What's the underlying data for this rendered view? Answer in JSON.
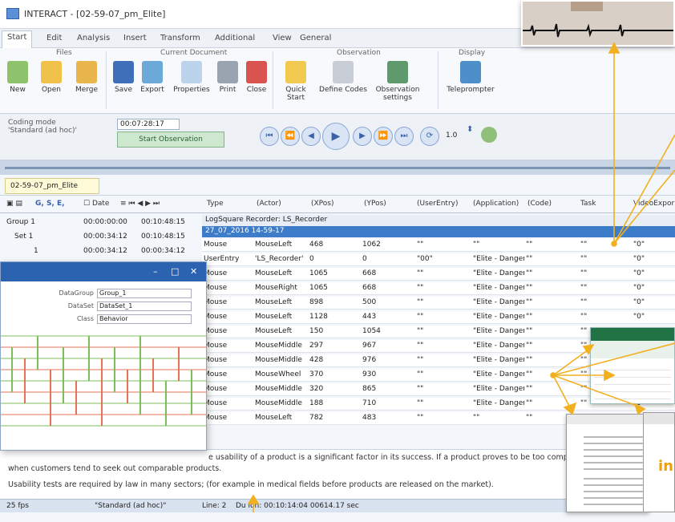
{
  "window": {
    "title": "INTERACT - [02-59-07_pm_Elite]"
  },
  "menu": [
    "Start",
    "Edit",
    "Analysis",
    "Insert",
    "Transform",
    "Additional",
    "View",
    "General"
  ],
  "ribbon": {
    "groups": {
      "files": "Files",
      "current_document": "Current Document",
      "observation": "Observation",
      "display": "Display"
    },
    "buttons": {
      "new": "New",
      "open": "Open",
      "merge": "Merge",
      "save": "Save",
      "export": "Export",
      "properties": "Properties",
      "print": "Print",
      "close": "Close",
      "quick_start": "Quick Start",
      "define_codes": "Define Codes",
      "observation_settings": "Observation settings",
      "teleprompter": "Teleprompter"
    }
  },
  "coding": {
    "mode_label": "Coding mode",
    "mode_value": "'Standard (ad hoc)'",
    "time": "00:07:28:17",
    "start_button": "Start Observation",
    "speed": "1.0"
  },
  "document_tab": "02-59-07_pm_Elite",
  "grid_toolbar": {
    "date_label": "Date"
  },
  "grid_headers": [
    "Type",
    "(Actor)",
    "(XPos)",
    "(YPos)",
    "(UserEntry)",
    "(Application)",
    "(Code)",
    "Task",
    "VideoExpor"
  ],
  "tree": [
    {
      "label": "Group 1",
      "start": "00:00:00:00",
      "end": "00:10:48:15"
    },
    {
      "label": "Set 1",
      "start": "00:00:34:12",
      "end": "00:10:48:15"
    },
    {
      "label": "1",
      "start": "00:00:34:12",
      "end": "00:00:34:12"
    }
  ],
  "recorder_label": "LogSquare Recorder: LS_Recorder",
  "selected_row": "27_07_2016 14-59-17",
  "rows": [
    [
      "Mouse",
      "MouseLeft",
      "468",
      "1062",
      "\"\"",
      "\"\"",
      "\"\"",
      "\"\"",
      "\"0\""
    ],
    [
      "UserEntry",
      "'LS_Recorder'",
      "0",
      "0",
      "\"00\"",
      "\"Elite - Danger",
      "\"\"",
      "\"\"",
      "\"0\""
    ],
    [
      "Mouse",
      "MouseLeft",
      "1065",
      "668",
      "\"\"",
      "\"Elite - Danger",
      "\"\"",
      "\"\"",
      "\"0\""
    ],
    [
      "Mouse",
      "MouseRight",
      "1065",
      "668",
      "\"\"",
      "\"Elite - Danger",
      "\"\"",
      "\"\"",
      "\"0\""
    ],
    [
      "Mouse",
      "MouseLeft",
      "898",
      "500",
      "\"\"",
      "\"Elite - Danger",
      "\"\"",
      "\"\"",
      "\"0\""
    ],
    [
      "Mouse",
      "MouseLeft",
      "1128",
      "443",
      "\"\"",
      "\"Elite - Danger",
      "\"\"",
      "\"\"",
      "\"0\""
    ],
    [
      "Mouse",
      "MouseLeft",
      "150",
      "1054",
      "\"\"",
      "\"Elite - Danger",
      "\"\"",
      "\"\"",
      "\"0\""
    ],
    [
      "Mouse",
      "MouseMiddle",
      "297",
      "967",
      "\"\"",
      "\"Elite - Danger",
      "\"\"",
      "\"\"",
      "\"0\""
    ],
    [
      "Mouse",
      "MouseMiddle",
      "428",
      "976",
      "\"\"",
      "\"Elite - Danger",
      "\"\"",
      "\"\"",
      "\"0\""
    ],
    [
      "Mouse",
      "MouseWheel",
      "370",
      "930",
      "\"\"",
      "\"Elite - Danger",
      "\"\"",
      "\"\"",
      "\"0\""
    ],
    [
      "Mouse",
      "MouseMiddle",
      "320",
      "865",
      "\"\"",
      "\"Elite - Danger",
      "\"\"",
      "\"\"",
      "\"0\""
    ],
    [
      "Mouse",
      "MouseMiddle",
      "188",
      "710",
      "\"\"",
      "\"Elite - Danger",
      "\"\"",
      "\"\"",
      "\"0\""
    ],
    [
      "Mouse",
      "MouseLeft",
      "782",
      "483",
      "\"\"",
      "\"\"",
      "\"\"",
      "\"\"",
      "\"0\""
    ]
  ],
  "transcript": {
    "line1": "e usability of a product is a significant factor in its success. If a product proves to be too complicated",
    "line2": "when customers tend to seek out comparable products.",
    "line3": "Usability tests are required by law in many sectors; (for example in medical fields before products are released on the market)."
  },
  "status": {
    "fps": "25 fps",
    "mode": "\"Standard (ad hoc)\"",
    "line": "Line: 2",
    "duration": "Du   ion: 00:10:14:04   00614.17 sec"
  },
  "chart_window": {
    "labels": {
      "datagroup": "DataGroup",
      "dataset": "DataSet",
      "class": "Class"
    },
    "values": {
      "datagroup": "Group_1",
      "dataset": "DataSet_1",
      "class": "Behavior"
    },
    "buttons": [
      "–",
      "□",
      "✕"
    ]
  },
  "colors": {
    "accent": "#3d7cc9",
    "arrow": "#f2b01e",
    "green": "#7cbf5a",
    "red": "#e0735a"
  }
}
